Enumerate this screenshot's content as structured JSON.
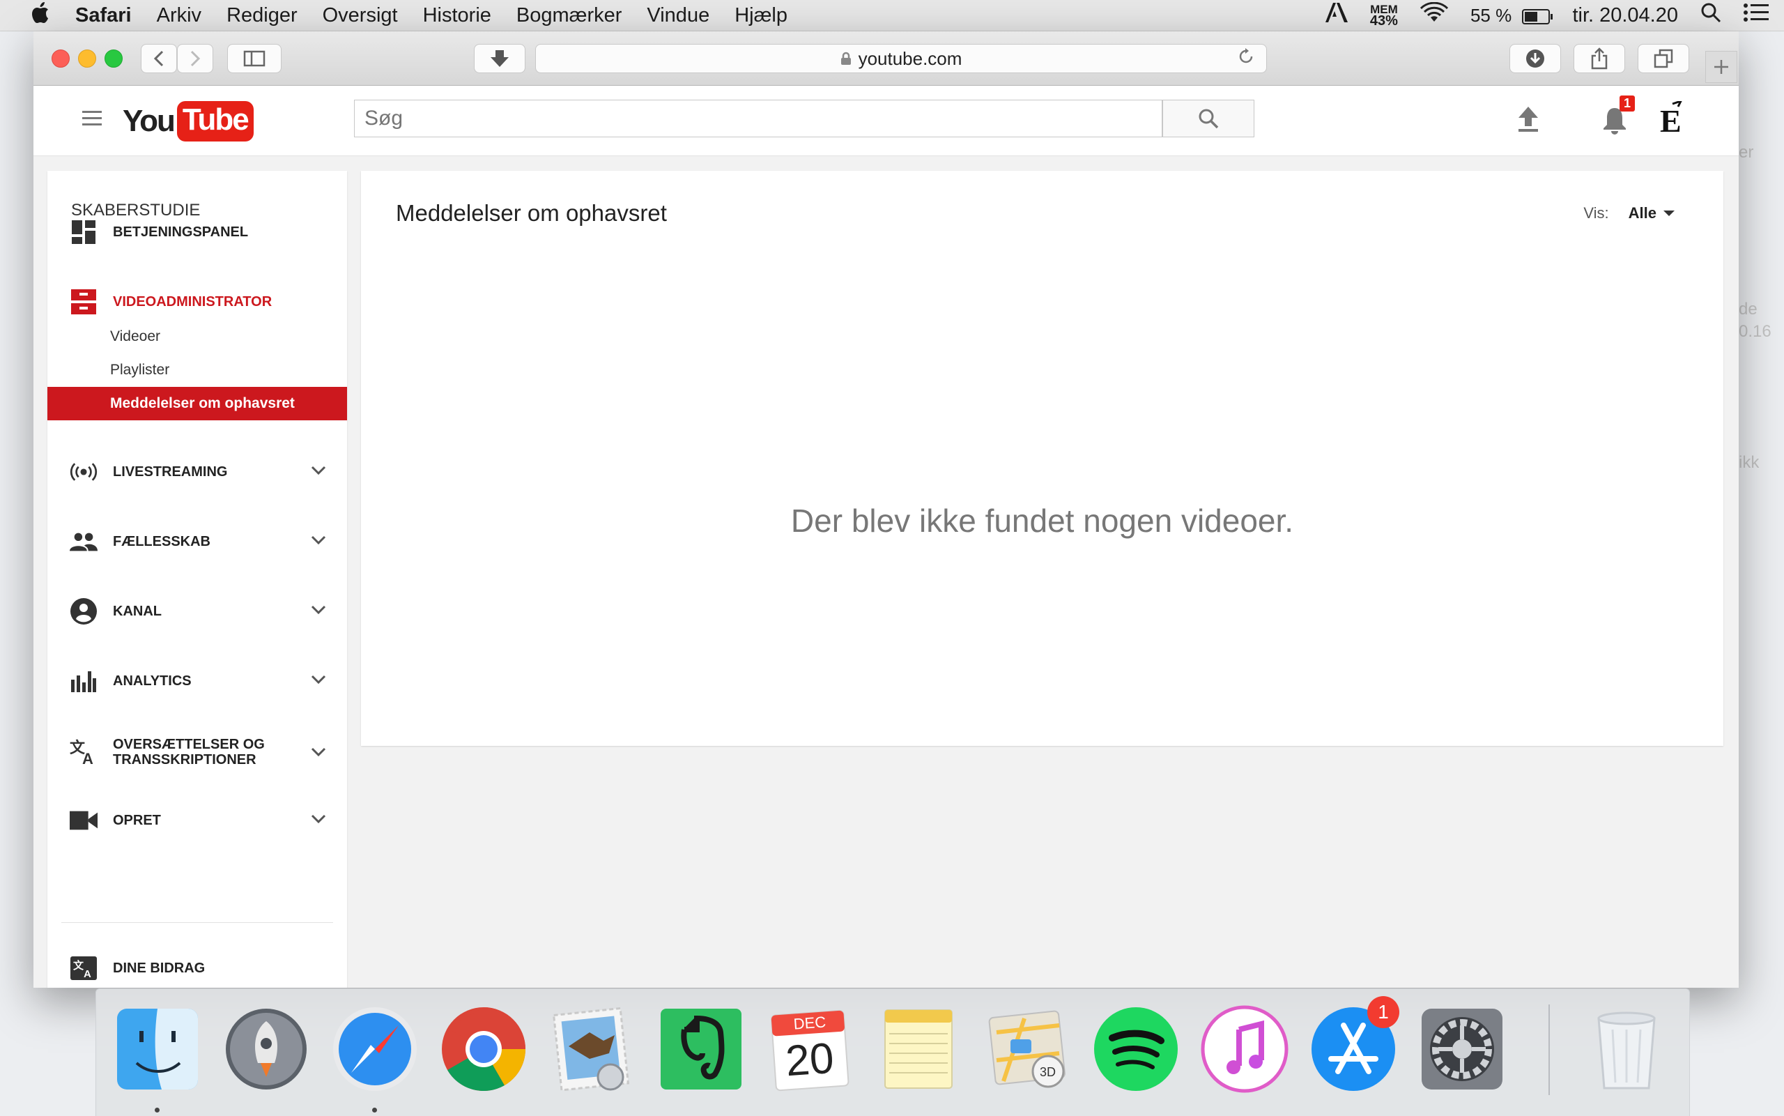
{
  "menubar": {
    "app": "Safari",
    "items": [
      "Arkiv",
      "Rediger",
      "Oversigt",
      "Historie",
      "Bogmærker",
      "Vindue",
      "Hjælp"
    ],
    "mem_label": "MEM",
    "mem_value": "43%",
    "battery": "55 %",
    "battery_level": 0.55,
    "clock": "tir. 20.04.20"
  },
  "browser": {
    "url": "youtube.com"
  },
  "youtube": {
    "logo_you": "You",
    "logo_tube": "Tube",
    "search_placeholder": "Søg",
    "notifications_count": "1"
  },
  "sidebar": {
    "title": "SKABERSTUDIE",
    "dashboard": "BETJENINGSPANEL",
    "video_manager": "VIDEOADMINISTRATOR",
    "sub_items": [
      "Videoer",
      "Playlister",
      "Meddelelser om ophavsret"
    ],
    "livestreaming": "LIVESTREAMING",
    "community": "FÆLLESSKAB",
    "channel": "KANAL",
    "analytics": "ANALYTICS",
    "translations_line1": "OVERSÆTTELSER OG",
    "translations_line2": "TRANSSKRIPTIONER",
    "create": "OPRET",
    "contributions": "DINE BIDRAG"
  },
  "main": {
    "title": "Meddelelser om ophavsret",
    "filter_label": "Vis:",
    "filter_value": "Alle",
    "empty_message": "Der blev ikke fundet nogen videoer."
  },
  "dock": {
    "calendar_month": "DEC",
    "calendar_day": "20",
    "appstore_badge": "1"
  },
  "desktop_hint": [
    "er",
    "de",
    "0.16",
    "ikk"
  ]
}
